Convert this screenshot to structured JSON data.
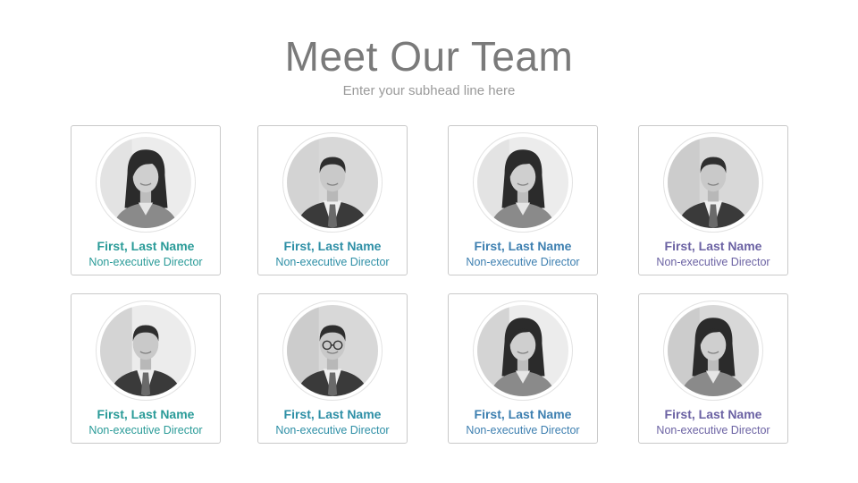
{
  "header": {
    "title": "Meet Our Team",
    "subtitle": "Enter your subhead line here"
  },
  "members": [
    {
      "name": "First, Last Name",
      "role": "Non-executive Director",
      "color": "#2a9b98",
      "photo": "woman-long-hair-portrait"
    },
    {
      "name": "First, Last Name",
      "role": "Non-executive Director",
      "color": "#2e8fa6",
      "photo": "man-suit-portrait"
    },
    {
      "name": "First, Last Name",
      "role": "Non-executive Director",
      "color": "#3d7fb0",
      "photo": "woman-office-portrait"
    },
    {
      "name": "First, Last Name",
      "role": "Non-executive Director",
      "color": "#6b62a3",
      "photo": "man-shirt-office-portrait"
    },
    {
      "name": "First, Last Name",
      "role": "Non-executive Director",
      "color": "#2a9b98",
      "photo": "man-tie-thumbs-up-portrait"
    },
    {
      "name": "First, Last Name",
      "role": "Non-executive Director",
      "color": "#2e8fa6",
      "photo": "man-glasses-portrait"
    },
    {
      "name": "First, Last Name",
      "role": "Non-executive Director",
      "color": "#3d7fb0",
      "photo": "woman-arms-crossed-portrait"
    },
    {
      "name": "First, Last Name",
      "role": "Non-executive Director",
      "color": "#6b62a3",
      "photo": "woman-meeting-portrait"
    }
  ]
}
